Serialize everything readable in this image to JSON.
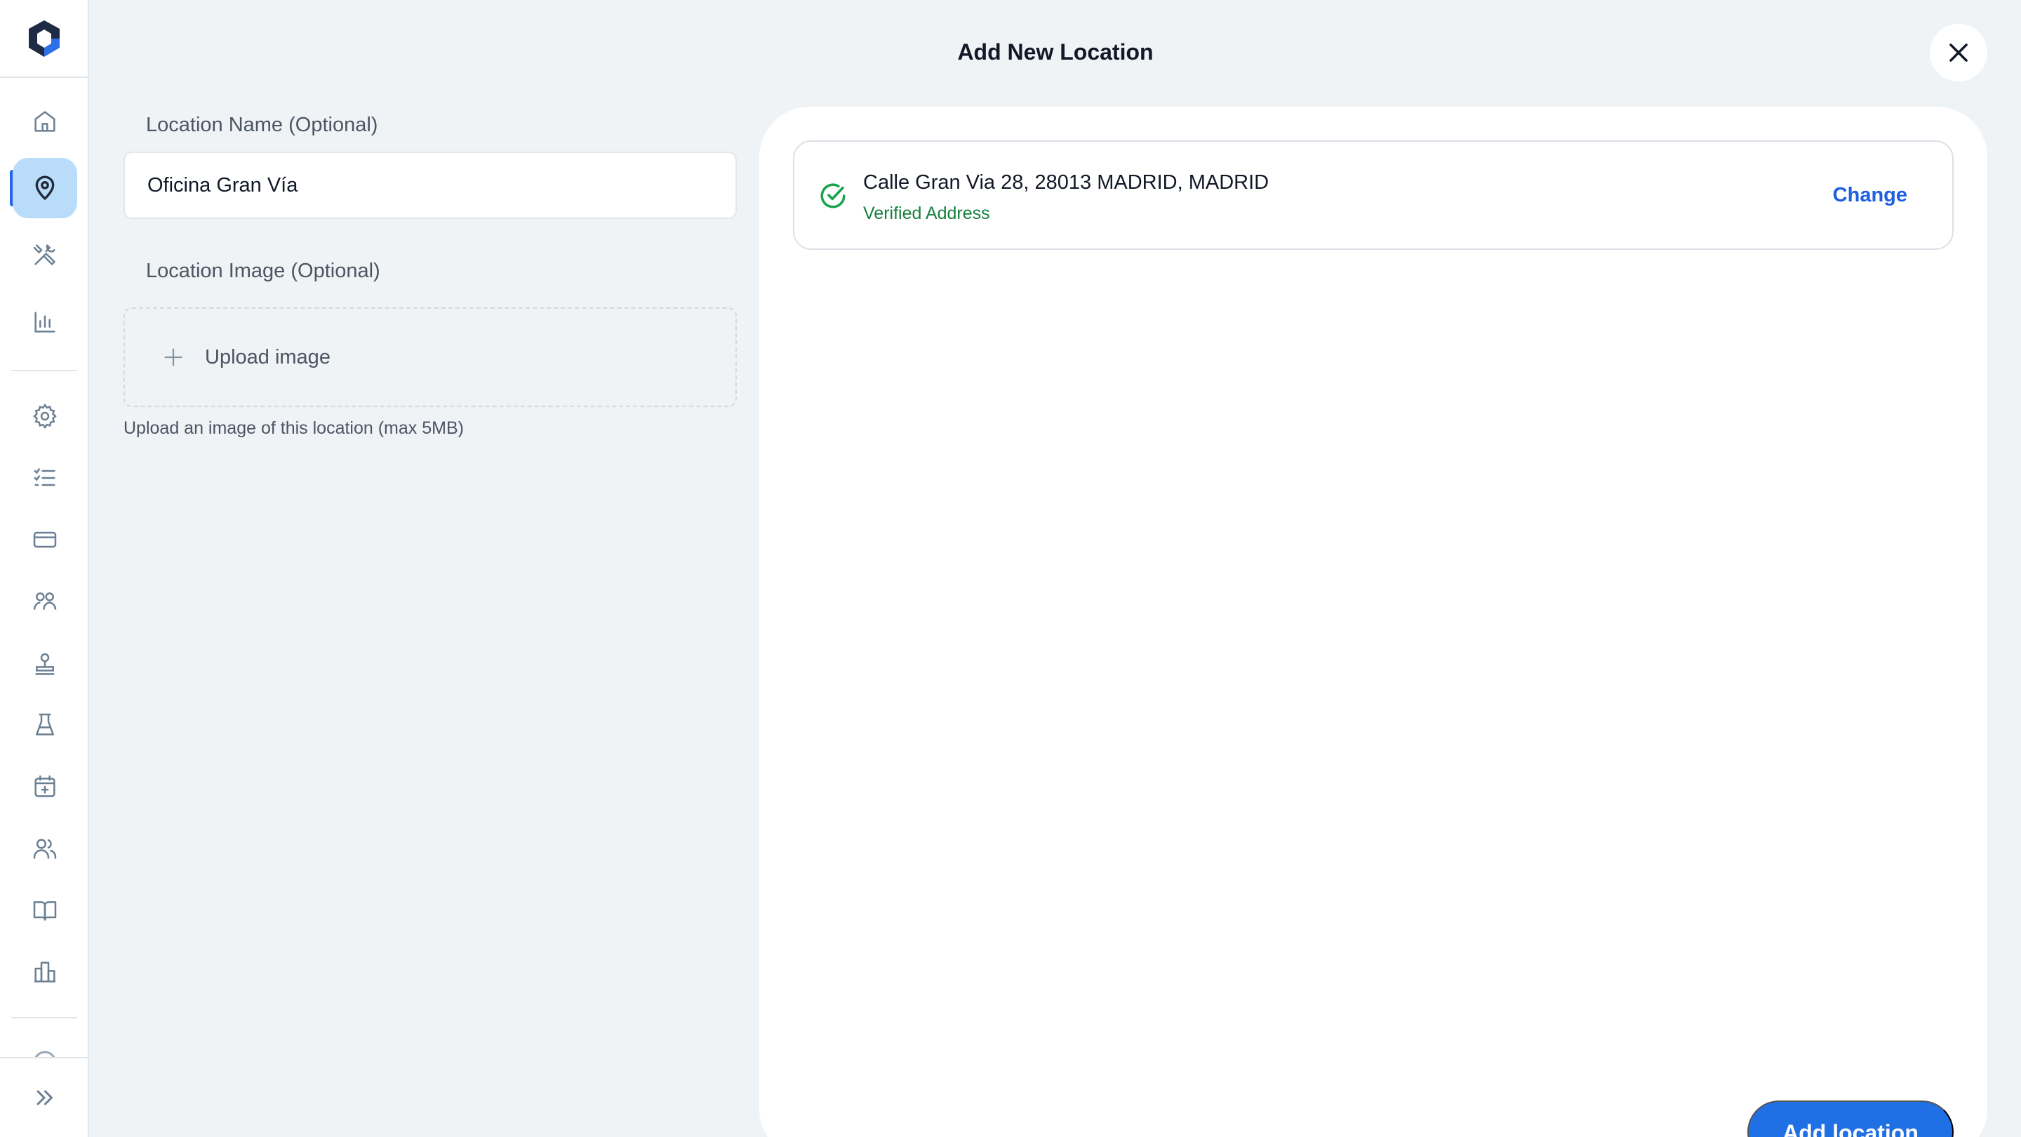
{
  "header": {
    "title": "Add New Location",
    "close_icon": "close-icon"
  },
  "sidebar": {
    "items": [
      {
        "name": "home",
        "icon": "home-icon",
        "active": false
      },
      {
        "name": "locations",
        "icon": "map-pin-icon",
        "active": true
      },
      {
        "name": "tools",
        "icon": "tools-icon",
        "active": false
      },
      {
        "name": "analytics",
        "icon": "bar-chart-icon",
        "active": false
      },
      {
        "name": "settings",
        "icon": "gear-icon",
        "active": false
      },
      {
        "name": "checklist",
        "icon": "checklist-icon",
        "active": false
      },
      {
        "name": "billing",
        "icon": "credit-card-icon",
        "active": false
      },
      {
        "name": "teams",
        "icon": "team-icon",
        "active": false
      },
      {
        "name": "stamp",
        "icon": "stamp-icon",
        "active": false
      },
      {
        "name": "lab",
        "icon": "flask-icon",
        "active": false
      },
      {
        "name": "calendar",
        "icon": "calendar-add-icon",
        "active": false
      },
      {
        "name": "users",
        "icon": "users-icon",
        "active": false
      },
      {
        "name": "docs",
        "icon": "book-icon",
        "active": false
      },
      {
        "name": "buildings",
        "icon": "building-icon",
        "active": false
      }
    ],
    "expand_icon": "double-chevron-right-icon"
  },
  "form": {
    "name_label": "Location Name (Optional)",
    "name_value": "Oficina Gran Vía",
    "image_label": "Location Image (Optional)",
    "upload_label": "Upload image",
    "upload_help": "Upload an image of this location (max 5MB)"
  },
  "address": {
    "line": "Calle Gran Via 28, 28013 MADRID, MADRID",
    "status": "Verified Address",
    "change_label": "Change"
  },
  "actions": {
    "submit_label": "Add location"
  },
  "colors": {
    "accent": "#1f6fe5",
    "verified": "#15803d",
    "active_nav_bg": "#b9dcfa",
    "page_bg": "#eff3f6"
  }
}
